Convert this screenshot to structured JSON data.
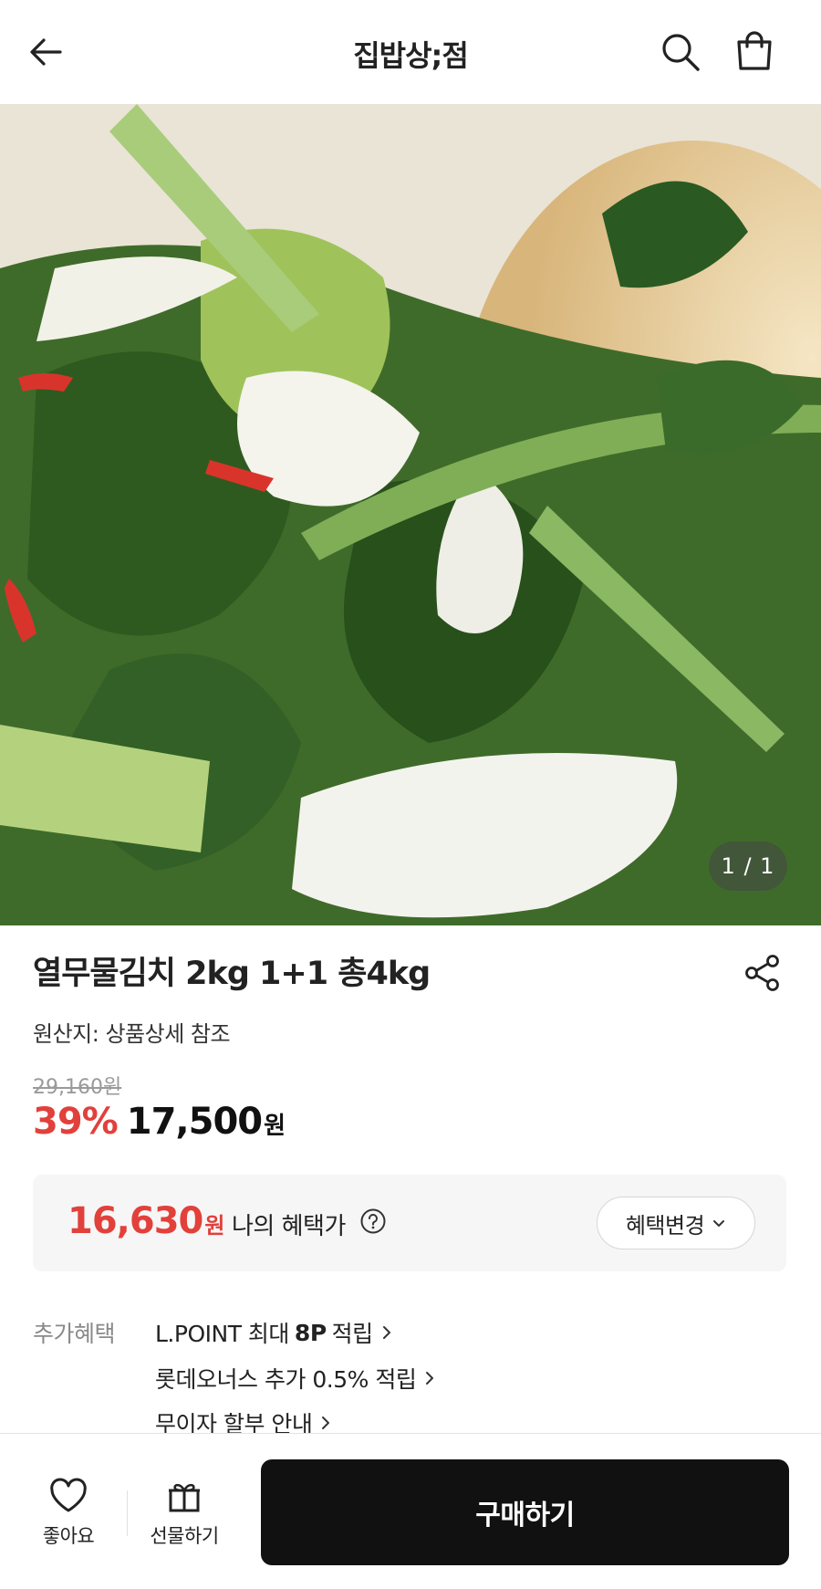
{
  "header": {
    "title": "집밥상;점",
    "back_icon": "arrow-left-icon",
    "search_icon": "search-icon",
    "cart_icon": "shopping-bag-icon"
  },
  "hero": {
    "pager": "1 / 1",
    "image_desc": "product-photo"
  },
  "product": {
    "title": "열무물김치 2kg 1+1 총4kg",
    "origin": "원산지: 상품상세 참조",
    "original_price": "29,160원",
    "discount": "39%",
    "sale_price": "17,500",
    "sale_unit": "원"
  },
  "benefit": {
    "price": "16,630",
    "unit": "원",
    "label": "나의 혜택가",
    "change_button": "혜택변경"
  },
  "additional": {
    "label": "추가혜택",
    "items": [
      {
        "prefix": "L.POINT 최대 ",
        "strong": "8P",
        "suffix": " 적립"
      },
      {
        "prefix": "롯데오너스 추가 0.5% 적립",
        "strong": "",
        "suffix": ""
      },
      {
        "prefix": "무이자 할부 안내",
        "strong": "",
        "suffix": ""
      }
    ]
  },
  "bottom": {
    "like_label": "좋아요",
    "gift_label": "선물하기",
    "buy_label": "구매하기"
  },
  "colors": {
    "accent_red": "#e2403b",
    "buy_button": "#111111"
  }
}
